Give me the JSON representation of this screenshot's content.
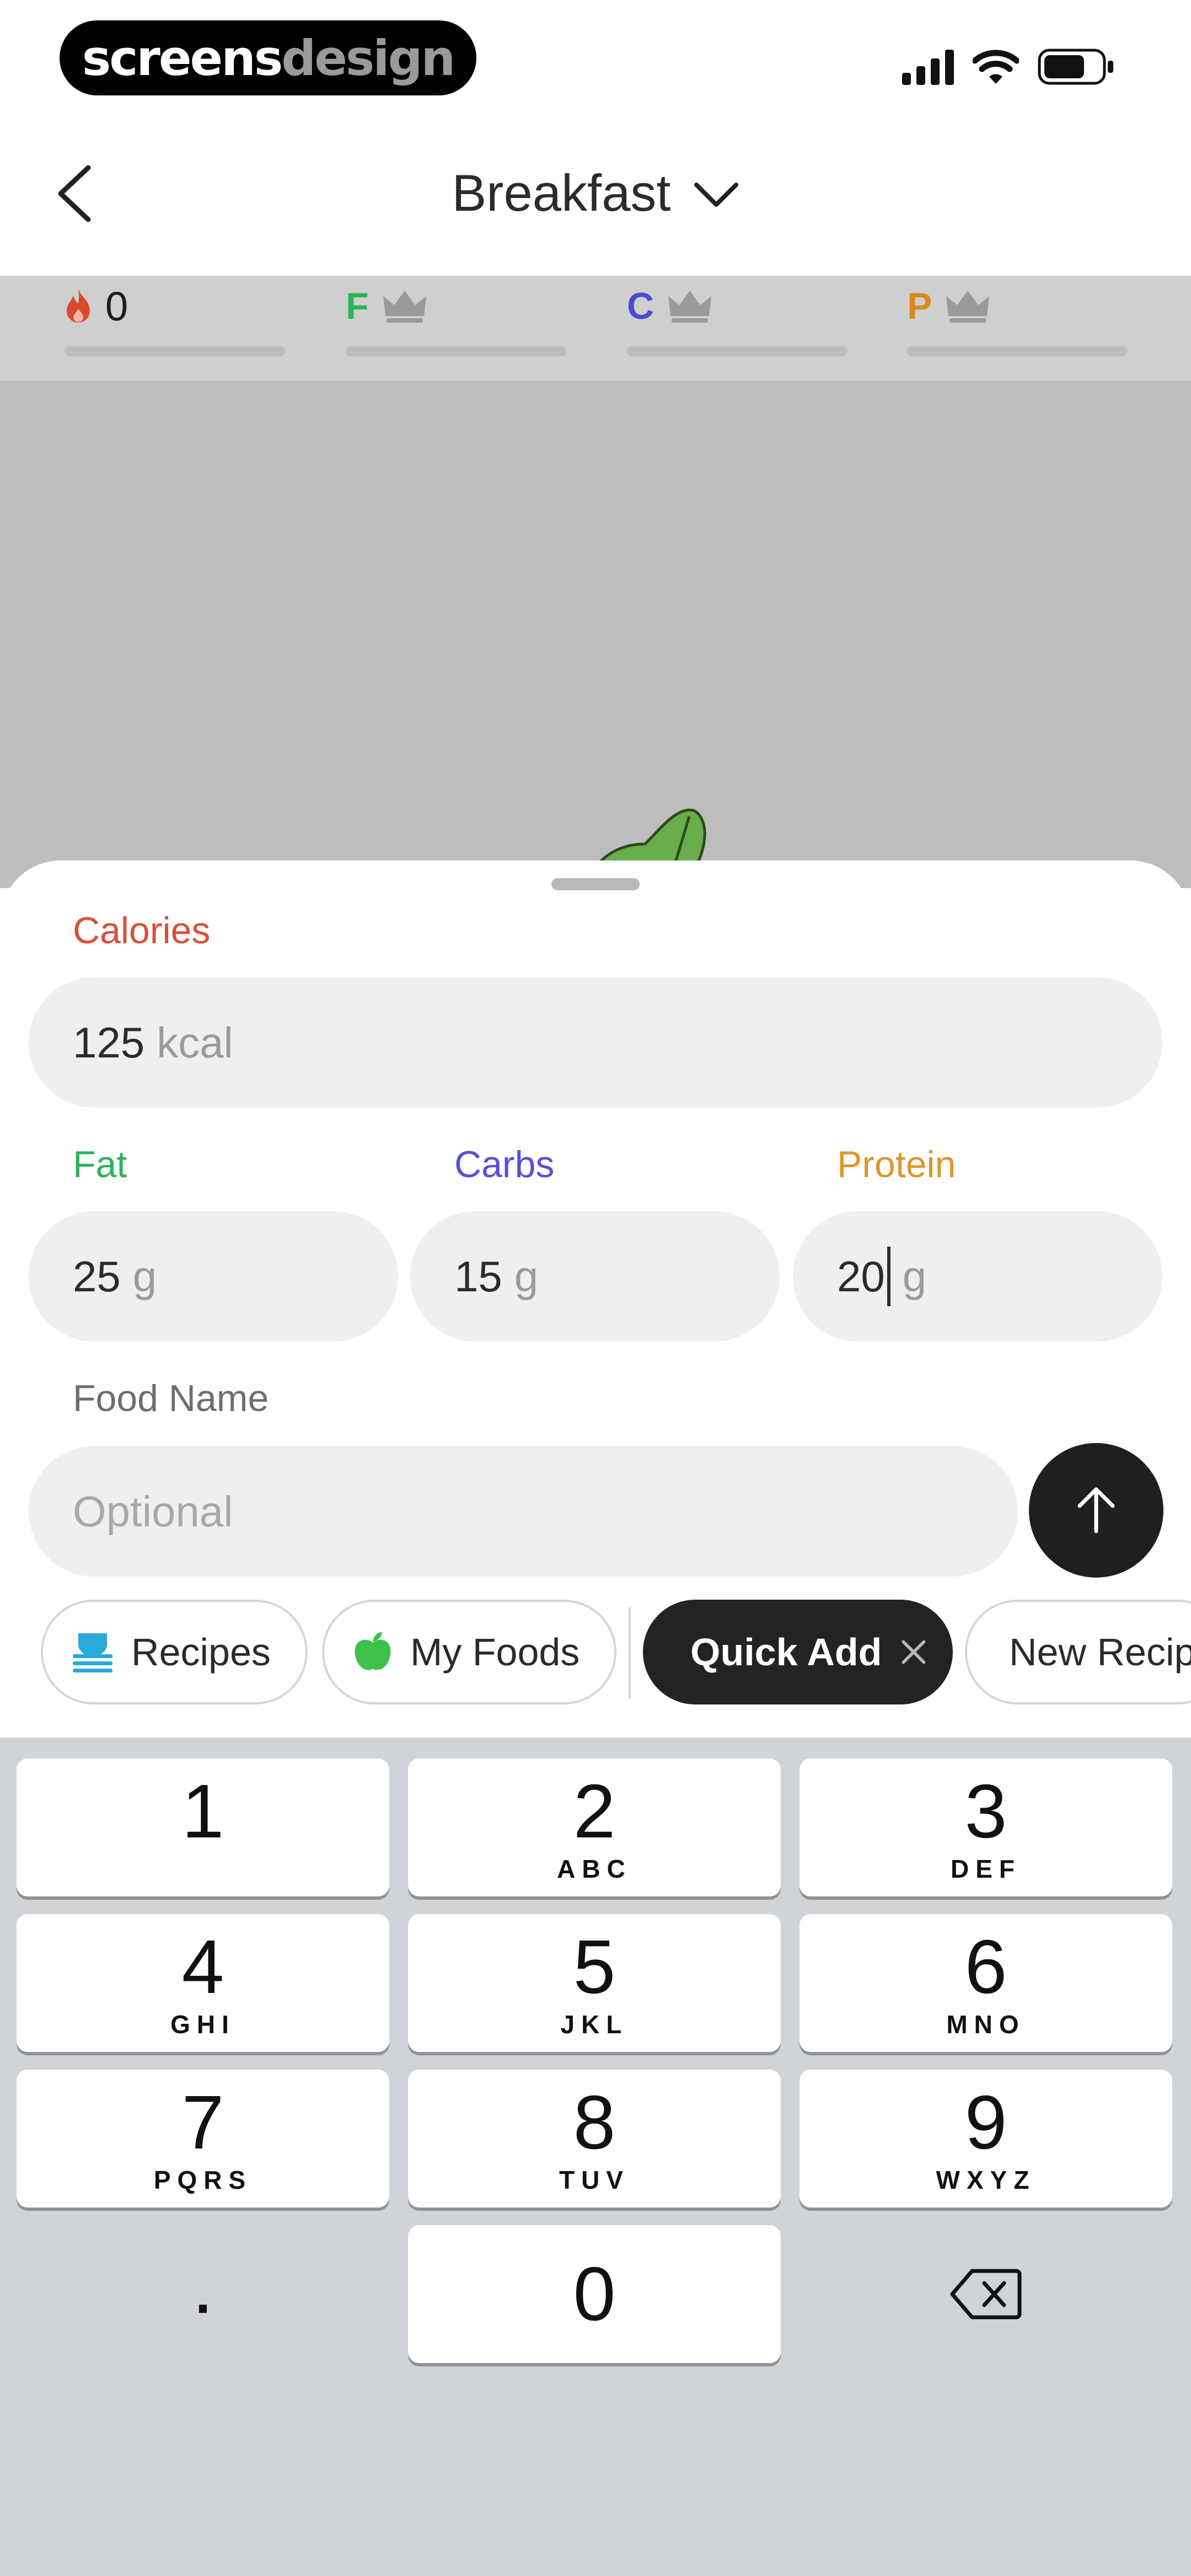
{
  "status_bar": {
    "brand": {
      "part1": "screens",
      "part2": "design"
    },
    "icons": {
      "signal": "signal-icon",
      "wifi": "wifi-icon",
      "battery": "battery-icon"
    }
  },
  "nav": {
    "title": "Breakfast",
    "back_icon": "chevron-left-icon",
    "dropdown_icon": "chevron-down-icon"
  },
  "macros": [
    {
      "letter": "",
      "value": "0",
      "icon": "flame-icon",
      "color": "#d9492f"
    },
    {
      "letter": "F",
      "value": "",
      "icon": "crown-icon",
      "color": "#2fb15a"
    },
    {
      "letter": "C",
      "value": "",
      "icon": "crown-icon",
      "color": "#4b4bd0"
    },
    {
      "letter": "P",
      "value": "",
      "icon": "crown-icon",
      "color": "#d88a1f"
    }
  ],
  "form": {
    "calories": {
      "label": "Calories",
      "value": "125",
      "unit": "kcal",
      "color": "#d9503a"
    },
    "fat": {
      "label": "Fat",
      "value": "25",
      "unit": "g",
      "color": "#2fb15a"
    },
    "carbs": {
      "label": "Carbs",
      "value": "15",
      "unit": "g",
      "color": "#5a4fd6"
    },
    "protein": {
      "label": "Protein",
      "value": "20",
      "unit": "g",
      "color": "#e0962c"
    },
    "food_name": {
      "label": "Food Name",
      "placeholder": "Optional"
    },
    "send_icon": "arrow-up-icon"
  },
  "chips": [
    {
      "label": "Recipes",
      "icon": "recipes-icon",
      "active": false
    },
    {
      "label": "My Foods",
      "icon": "apple-icon",
      "active": false
    },
    {
      "label": "Quick Add",
      "icon": "close-icon",
      "active": true
    },
    {
      "label": "New Recip",
      "icon": "",
      "active": false
    }
  ],
  "keyboard": {
    "keys": [
      {
        "digit": "1",
        "letters": ""
      },
      {
        "digit": "2",
        "letters": "ABC"
      },
      {
        "digit": "3",
        "letters": "DEF"
      },
      {
        "digit": "4",
        "letters": "GHI"
      },
      {
        "digit": "5",
        "letters": "JKL"
      },
      {
        "digit": "6",
        "letters": "MNO"
      },
      {
        "digit": "7",
        "letters": "PQRS"
      },
      {
        "digit": "8",
        "letters": "TUV"
      },
      {
        "digit": "9",
        "letters": "WXYZ"
      },
      {
        "digit": "0",
        "letters": ""
      }
    ],
    "decimal": ".",
    "delete_icon": "backspace-icon"
  }
}
